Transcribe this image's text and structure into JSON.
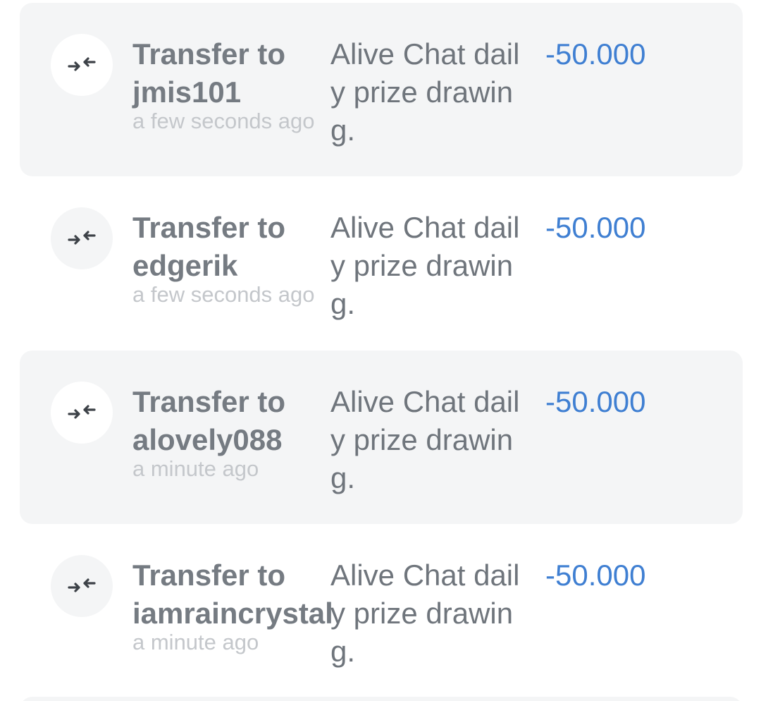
{
  "transactions": [
    {
      "title_prefix": "Transfer to",
      "recipient": "jmis101",
      "time": "a few seconds ago",
      "memo": "Alive Chat daily prize drawing.",
      "amount": "-50.000",
      "icon": "transfer-arrows-icon"
    },
    {
      "title_prefix": "Transfer to",
      "recipient": "edgerik",
      "time": "a few seconds ago",
      "memo": "Alive Chat daily prize drawing.",
      "amount": "-50.000",
      "icon": "transfer-arrows-icon"
    },
    {
      "title_prefix": "Transfer to",
      "recipient": "alovely088",
      "time": "a minute ago",
      "memo": "Alive Chat daily prize drawing.",
      "amount": "-50.000",
      "icon": "transfer-arrows-icon"
    },
    {
      "title_prefix": "Transfer to",
      "recipient": "iamraincrystal",
      "time": "a minute ago",
      "memo": "Alive Chat daily prize drawing.",
      "amount": "-50.000",
      "icon": "transfer-arrows-icon"
    }
  ],
  "colors": {
    "card_shaded": "#f4f5f6",
    "title_text": "#757b82",
    "time_text": "#c4c7cb",
    "memo_text": "#6f757c",
    "amount_text": "#3f7fd2",
    "icon_stroke": "#3d4248"
  }
}
